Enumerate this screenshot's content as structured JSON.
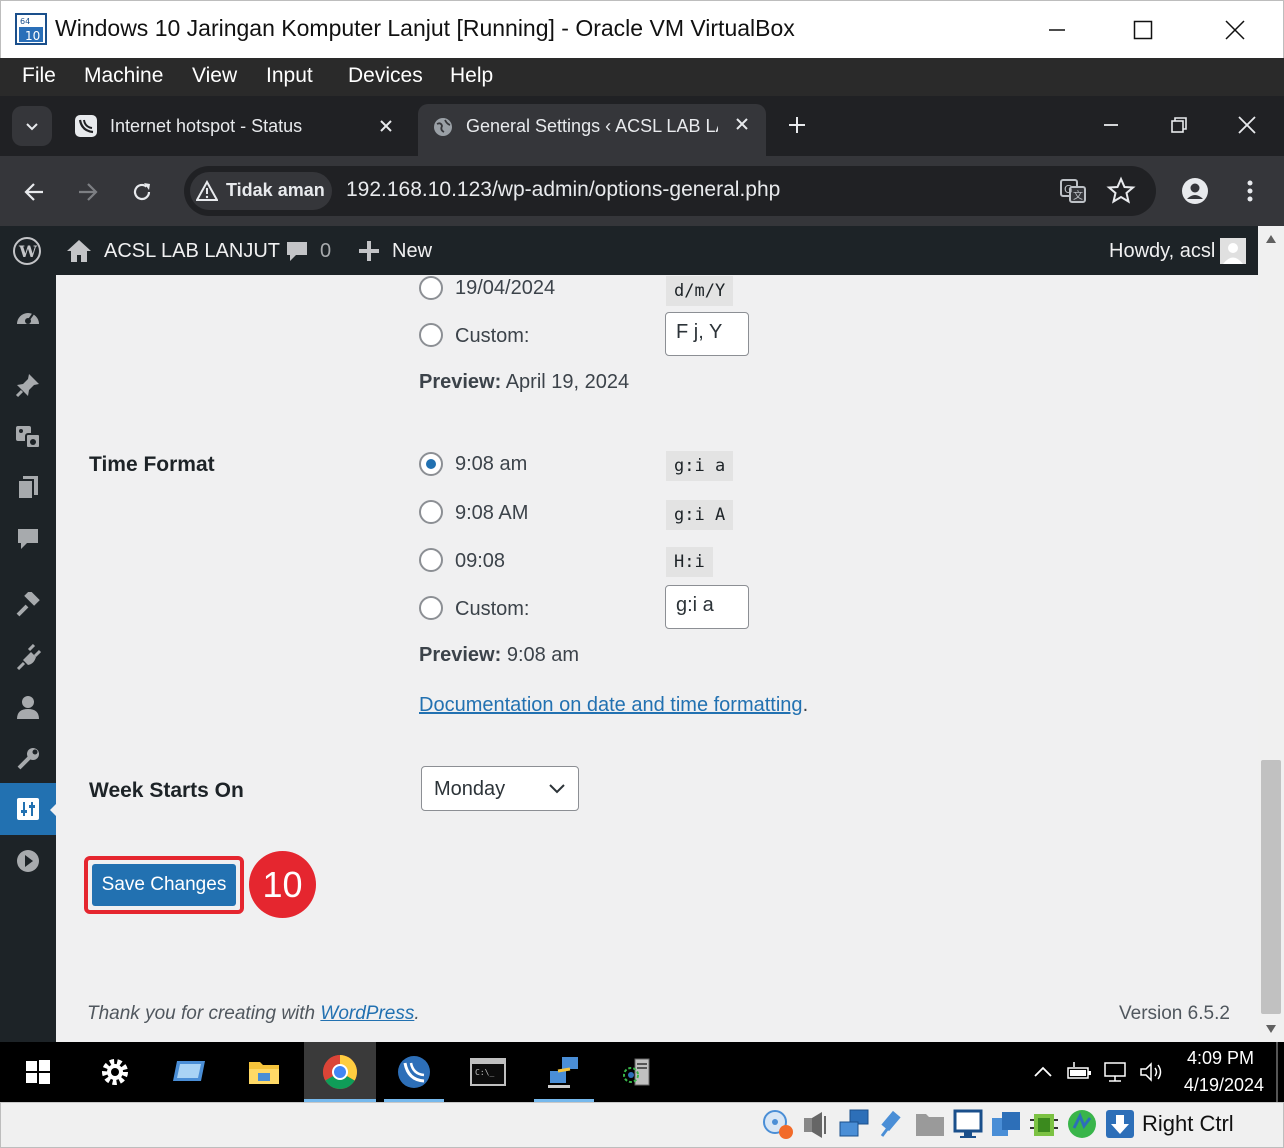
{
  "vbox": {
    "title": "Windows 10 Jaringan Komputer Lanjut [Running] - Oracle VM VirtualBox",
    "menu": [
      "File",
      "Machine",
      "View",
      "Input",
      "Devices",
      "Help"
    ],
    "host_key": "Right Ctrl"
  },
  "chrome": {
    "tabs": [
      {
        "label": "Internet hotspot - Status"
      },
      {
        "label": "General Settings ‹ ACSL LAB LA"
      }
    ],
    "security_label": "Tidak aman",
    "url": "192.168.10.123/wp-admin/options-general.php"
  },
  "adminbar": {
    "site_name": "ACSL LAB LANJUT",
    "comments_count": "0",
    "new_label": "New",
    "howdy": "Howdy, acsl"
  },
  "date_format": {
    "options": [
      {
        "label": "19/04/2024",
        "code": "d/m/Y"
      },
      {
        "label": "Custom:",
        "value": "F j, Y"
      }
    ],
    "preview_label": "Preview:",
    "preview_value": "April 19, 2024"
  },
  "time_format": {
    "heading": "Time Format",
    "options": [
      {
        "label": "9:08 am",
        "code": "g:i a",
        "checked": true
      },
      {
        "label": "9:08 AM",
        "code": "g:i A",
        "checked": false
      },
      {
        "label": "09:08",
        "code": "H:i",
        "checked": false
      },
      {
        "label": "Custom:",
        "value": "g:i a",
        "checked": false
      }
    ],
    "preview_label": "Preview:",
    "preview_value": "9:08 am",
    "doc_link": "Documentation on date and time formatting",
    "doc_period": "."
  },
  "week_starts": {
    "heading": "Week Starts On",
    "selected": "Monday"
  },
  "save_button": "Save Changes",
  "step_badge": "10",
  "footer": {
    "thanks_prefix": "Thank you for creating with ",
    "wp_link": "WordPress",
    "thanks_suffix": ".",
    "version": "Version 6.5.2"
  },
  "taskbar": {
    "time": "4:09 PM",
    "date": "4/19/2024"
  },
  "colors": {
    "wp_blue": "#2271b1",
    "admin_dark": "#1d2327",
    "badge_red": "#e5262f"
  }
}
